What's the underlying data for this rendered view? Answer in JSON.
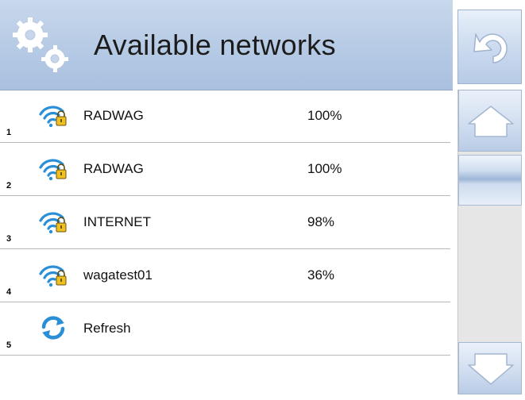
{
  "header": {
    "title": "Available networks",
    "icon": "gears-icon",
    "back_icon": "undo-arrow-icon"
  },
  "networks": [
    {
      "index": "1",
      "name": "RADWAG",
      "signal": "100%",
      "icon": "wifi-secured-icon"
    },
    {
      "index": "2",
      "name": "RADWAG",
      "signal": "100%",
      "icon": "wifi-secured-icon"
    },
    {
      "index": "3",
      "name": "INTERNET",
      "signal": "98%",
      "icon": "wifi-secured-icon"
    },
    {
      "index": "4",
      "name": "wagatest01",
      "signal": "36%",
      "icon": "wifi-secured-icon"
    }
  ],
  "refresh": {
    "index": "5",
    "label": "Refresh",
    "icon": "refresh-icon"
  },
  "colors": {
    "header_bg": "#b4c9e4",
    "accent_blue": "#2a8fd6",
    "lock_yellow": "#f0c020"
  }
}
